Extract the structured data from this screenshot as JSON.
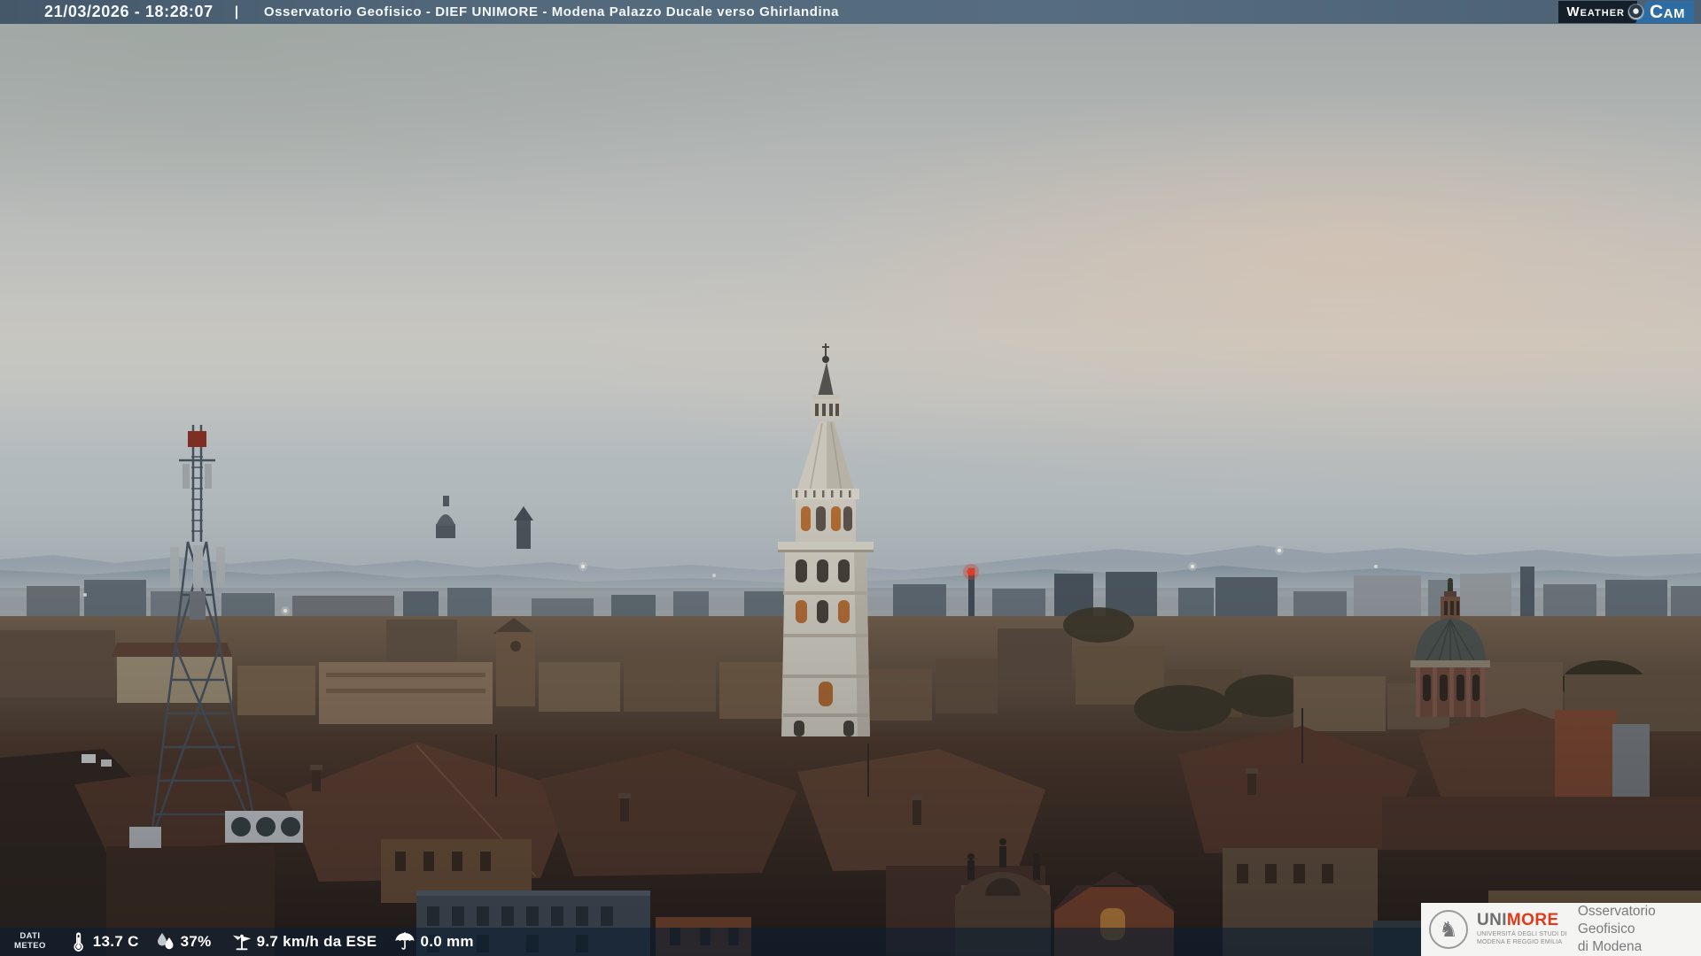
{
  "header": {
    "timestamp": "21/03/2026 - 18:28:07",
    "separator": "|",
    "title": "Osservatorio Geofisico - DIEF UNIMORE - Modena Palazzo Ducale verso Ghirlandina",
    "weathercam": {
      "weather": "Weather",
      "cam": "Cam"
    }
  },
  "meteo": {
    "label": "DATI\nMETEO",
    "temperature": "13.7 C",
    "humidity": "37%",
    "wind": "9.7 km/h da ESE",
    "precipitation": "0.0 mm"
  },
  "branding": {
    "seal_glyph": "♞",
    "uni": "UNI",
    "more": "MORE",
    "university": "UNIVERSITÀ DEGLI STUDI DI\nMODENA E REGGIO EMILIA",
    "observatory": "Osservatorio Geofisico\ndi Modena"
  },
  "colors": {
    "header_bar": "#4e6476",
    "header_text": "#f4f8fa",
    "weathercam_navy": "#141f29",
    "weathercam_blue": "#2e6da4",
    "unimore_red": "#e2391b",
    "unimore_gray": "#6f6f71",
    "meteo_bar_bg": "rgba(13,31,48,0.62)",
    "sky_top": "#a2a8a7",
    "sky_warm_band": "#dfc5b1",
    "mountains": "#8494a2",
    "roof_terracotta": "#5d3e2f",
    "tower_stone": "#cdc9be",
    "antenna_light_red": "#e6402c"
  }
}
